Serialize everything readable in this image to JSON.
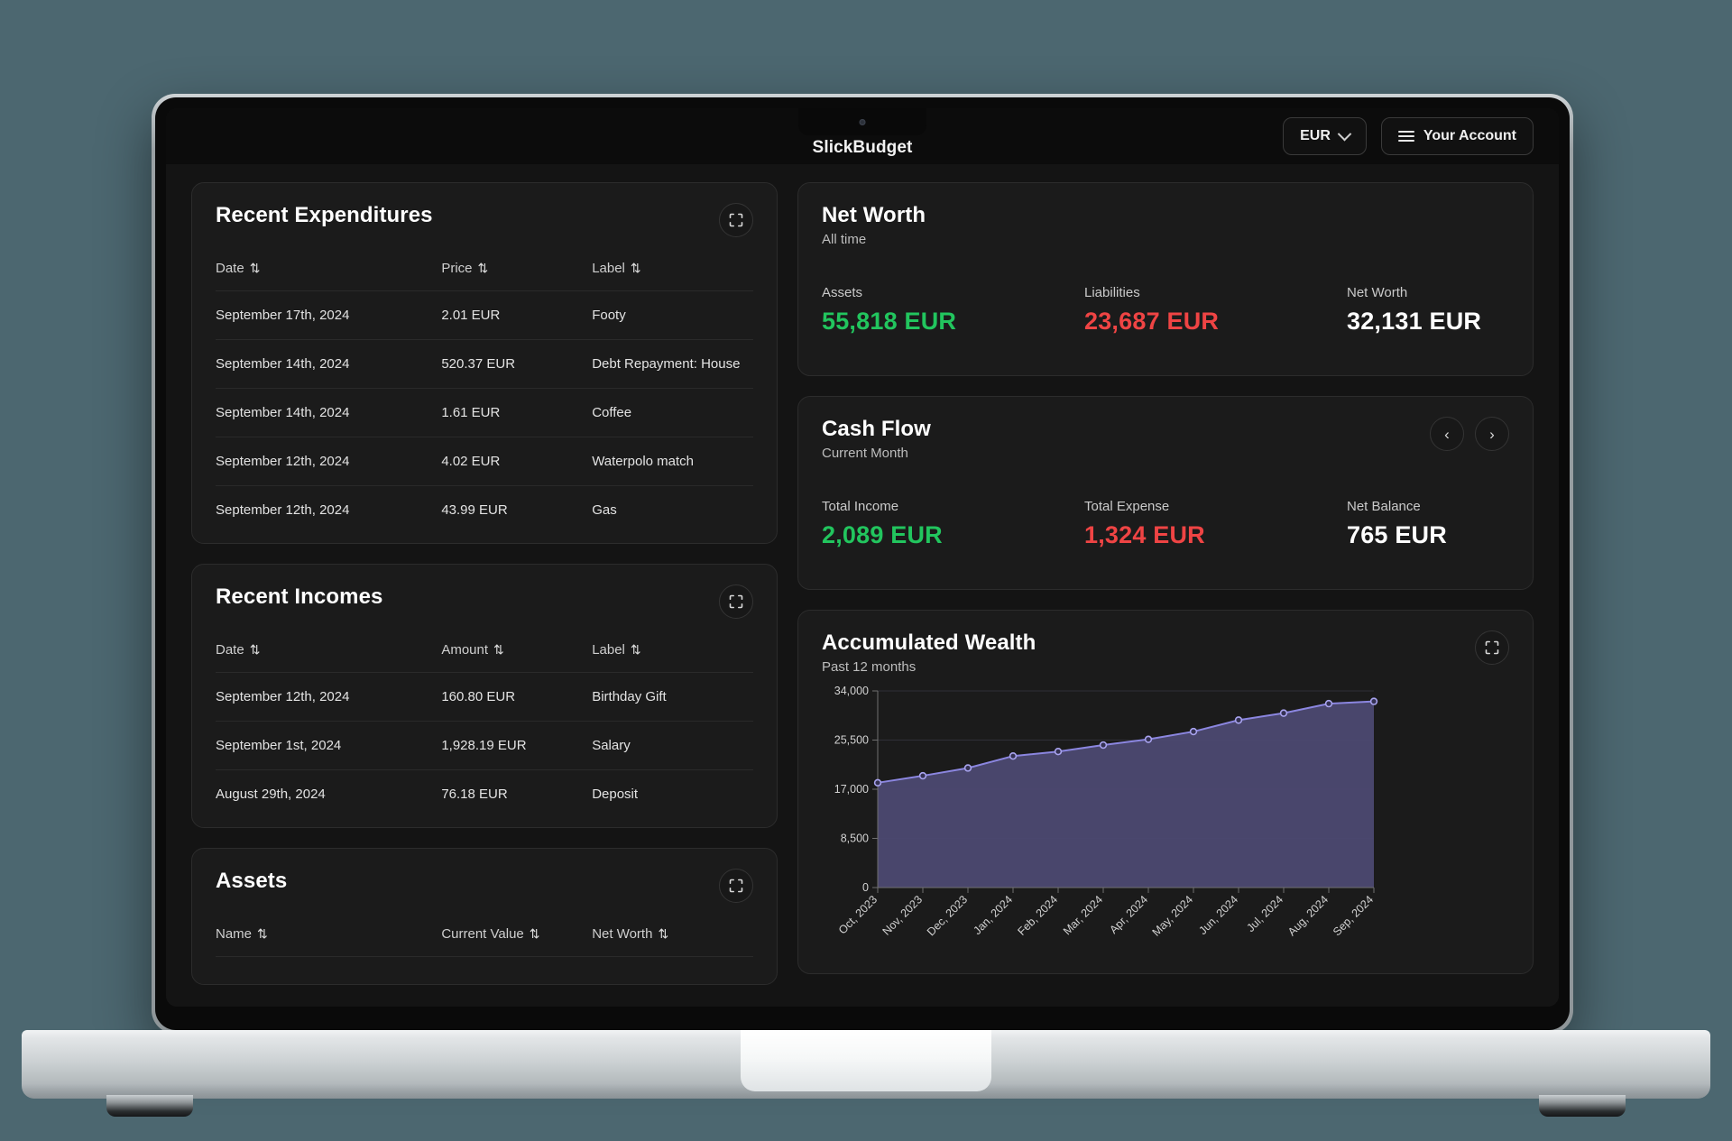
{
  "app": {
    "brand": "SlickBudget"
  },
  "topbar": {
    "currency": "EUR",
    "account_label": "Your Account"
  },
  "recent_expenditures": {
    "title": "Recent Expenditures",
    "expand_icon": "expand-icon",
    "columns": [
      "Date",
      "Price",
      "Label"
    ],
    "rows": [
      [
        "September 17th, 2024",
        "2.01 EUR",
        "Footy"
      ],
      [
        "September 14th, 2024",
        "520.37 EUR",
        "Debt Repayment: House"
      ],
      [
        "September 14th, 2024",
        "1.61 EUR",
        "Coffee"
      ],
      [
        "September 12th, 2024",
        "4.02 EUR",
        "Waterpolo match"
      ],
      [
        "September 12th, 2024",
        "43.99 EUR",
        "Gas"
      ]
    ]
  },
  "recent_incomes": {
    "title": "Recent Incomes",
    "columns": [
      "Date",
      "Amount",
      "Label"
    ],
    "rows": [
      [
        "September 12th, 2024",
        "160.80 EUR",
        "Birthday Gift"
      ],
      [
        "September 1st, 2024",
        "1,928.19 EUR",
        "Salary"
      ],
      [
        "August 29th, 2024",
        "76.18 EUR",
        "Deposit"
      ]
    ]
  },
  "assets": {
    "title": "Assets",
    "columns": [
      "Name",
      "Current Value",
      "Net Worth"
    ]
  },
  "net_worth": {
    "title": "Net Worth",
    "subtitle": "All time",
    "items": [
      {
        "label": "Assets",
        "value": "55,818 EUR",
        "color": "#22c55e"
      },
      {
        "label": "Liabilities",
        "value": "23,687 EUR",
        "color": "#ef4444"
      },
      {
        "label": "Net Worth",
        "value": "32,131 EUR",
        "color": "#ffffff"
      }
    ]
  },
  "cash_flow": {
    "title": "Cash Flow",
    "subtitle": "Current Month",
    "prev_label": "‹",
    "next_label": "›",
    "items": [
      {
        "label": "Total Income",
        "value": "2,089 EUR",
        "color": "#22c55e"
      },
      {
        "label": "Total Expense",
        "value": "1,324 EUR",
        "color": "#ef4444"
      },
      {
        "label": "Net Balance",
        "value": "765 EUR",
        "color": "#ffffff"
      }
    ]
  },
  "accumulated_wealth": {
    "title": "Accumulated Wealth",
    "subtitle": "Past 12 months"
  },
  "chart_data": {
    "type": "area",
    "title": "Accumulated Wealth",
    "subtitle": "Past 12 months",
    "xlabel": "",
    "ylabel": "",
    "grid": true,
    "legend": "none",
    "line_color": "#8b86e0",
    "fill_color": "#4d4a73",
    "point_color": "#a8a3ee",
    "ylim": [
      0,
      34000
    ],
    "yticks": [
      0,
      8500,
      17000,
      25500,
      34000
    ],
    "ytick_labels": [
      "0",
      "8,500",
      "17,000",
      "25,500",
      "34,000"
    ],
    "categories": [
      "Oct, 2023",
      "Nov, 2023",
      "Dec, 2023",
      "Jan, 2024",
      "Feb, 2024",
      "Mar, 2024",
      "Apr, 2024",
      "May, 2024",
      "Jun, 2024",
      "Jul, 2024",
      "Aug, 2024",
      "Sep, 2024"
    ],
    "values": [
      18120,
      19330,
      20670,
      22740,
      23520,
      24640,
      25630,
      26970,
      28950,
      30160,
      31800,
      32190
    ]
  }
}
